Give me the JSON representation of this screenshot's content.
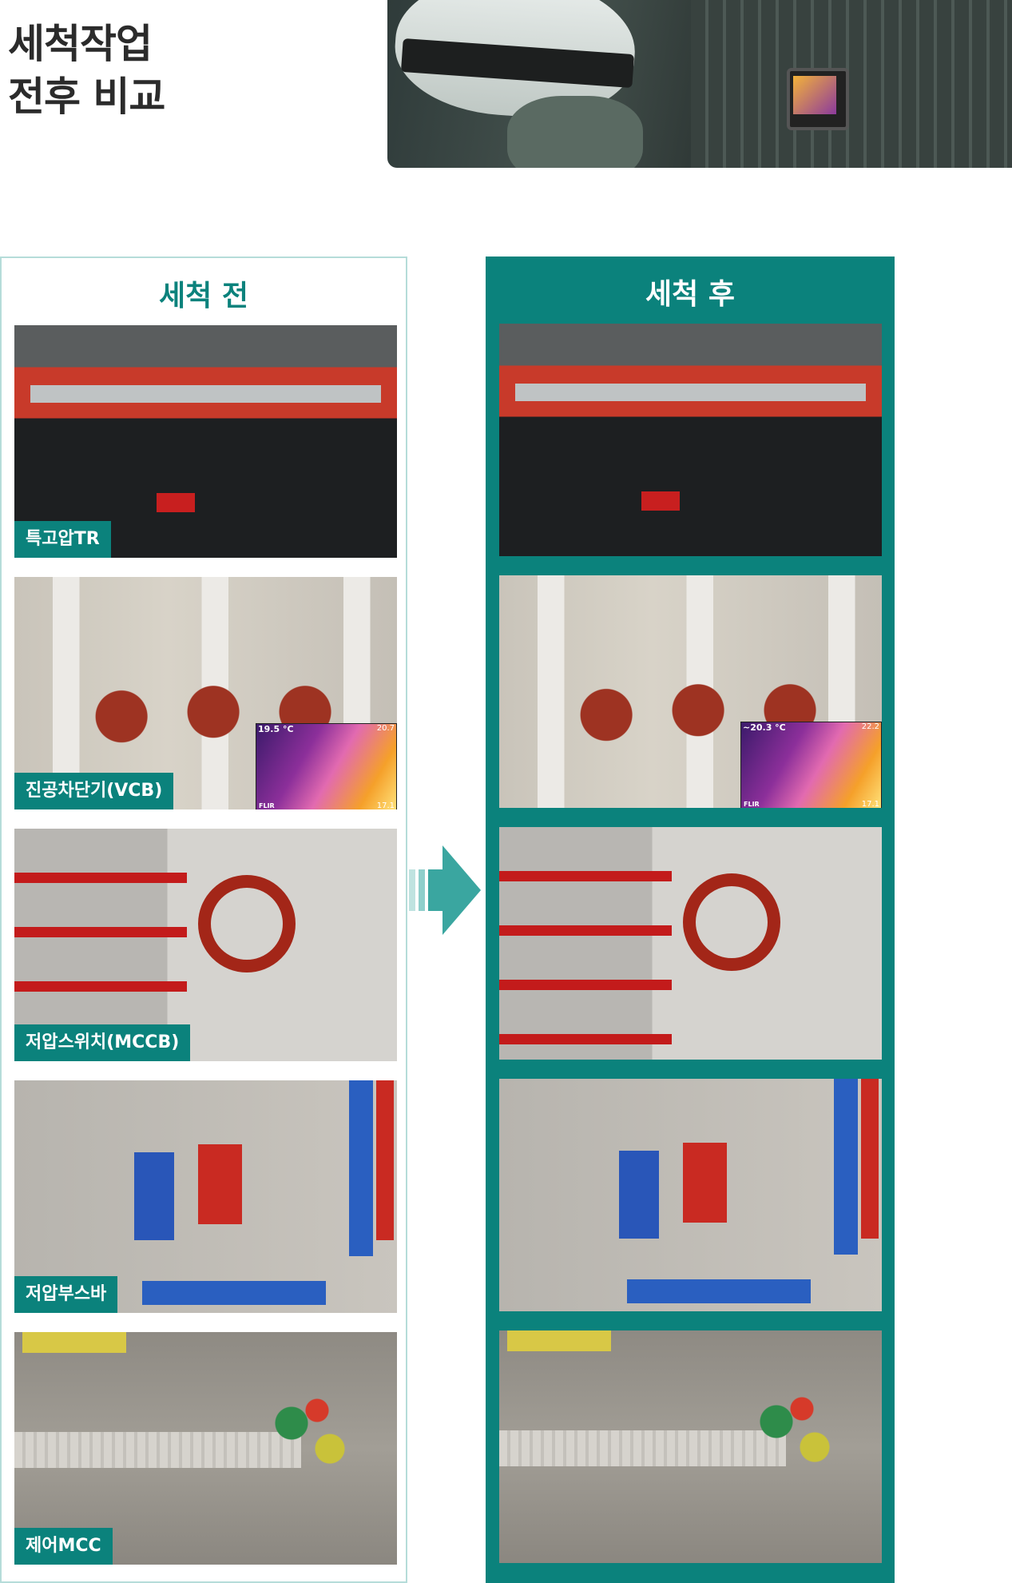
{
  "title": {
    "line1": "세척작업",
    "line2": "전후 비교"
  },
  "before": {
    "heading": "세척 전",
    "items": [
      {
        "label": "특고압TR"
      },
      {
        "label": "진공차단기(VCB)",
        "thermal": {
          "temp": "19.5",
          "unit": "°C",
          "max": "20.7",
          "min": "17.1",
          "brand": "FLIR"
        }
      },
      {
        "label": "저압스위치(MCCB)"
      },
      {
        "label": "저압부스바"
      },
      {
        "label": "제어MCC"
      }
    ]
  },
  "after": {
    "heading": "세척 후",
    "items": [
      {
        "label": ""
      },
      {
        "label": "",
        "thermal": {
          "temp": "~20.3",
          "unit": "°C",
          "max": "22.2",
          "min": "17.1",
          "brand": "FLIR"
        }
      },
      {
        "label": ""
      },
      {
        "label": ""
      },
      {
        "label": ""
      }
    ]
  },
  "colors": {
    "accent": "#0b827c",
    "border": "#b5dcd9"
  },
  "icons": {
    "arrow": "arrow-right-icon"
  }
}
